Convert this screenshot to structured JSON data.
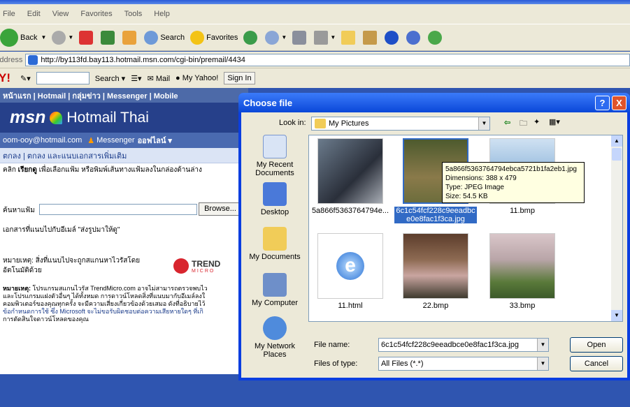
{
  "browser": {
    "menu": [
      "File",
      "Edit",
      "View",
      "Favorites",
      "Tools",
      "Help"
    ],
    "toolbar": {
      "back": "Back",
      "search": "Search",
      "favorites": "Favorites"
    },
    "address": {
      "label": "Address",
      "url": "http://by113fd.bay113.hotmail.msn.com/cgi-bin/premail/4434"
    },
    "yahoo": {
      "logo": "Y!",
      "search": "Search",
      "mail": "Mail",
      "my_yahoo": "My Yahoo!",
      "sign_in": "Sign In"
    }
  },
  "page": {
    "nav": "หน้าแรก | Hotmail | กลุ่มข่าว | Messenger | Mobile",
    "brand_msn": "msn",
    "brand_hotmail": "Hotmail Thai",
    "user": "oom-ooy@hotmail.com",
    "messenger": "Messenger",
    "status": "ออฟไลน์",
    "sub": "ตกลง | ตกลง และแนบเอกสารเพิ่มเติม",
    "instruction_prefix": "คลิก ",
    "instruction_bold": "เรียกดู",
    "instruction_rest": " เพื่อเลือกแฟ้ม หรือพิมพ์เส้นทางแฟ้มลงในกล่องด้านล่าง",
    "find_label": "ค้นหาแฟ้ม",
    "browse": "Browse...",
    "attach_text": "เอกสารที่แนบไปกับอีเมล์ \"ส่งรูปมาให้ดู\"",
    "note_label": "หมายเหตุ:",
    "note_line1": "หมายเหตุ: สิ่งที่แนบไปจะถูกสแกนหาไวรัสโดย",
    "note_line2": "อัตโนมัติด้วย",
    "trend_logo": "TREND",
    "trend_sub": "MICRO",
    "disclaimer_bold": "หมายเหตุ:",
    "disclaimer": [
      " โปรแกรมสแกนไวรัส TrendMicro.com อาจไม่สามารถตรวจพบไว",
      "และโปรแกรมแฝงตัวอื่นๆ ได้ทั้งหมด การดาวน์โหลดสิ่งที่แนบมากับอีเมล์ลงใ",
      "คอมพิวเตอร์ของคุณทุกครั้ง จะมีความเสี่ยงเกี่ยวข้องด้วยเสมอ ดังที่อธิบายไว้",
      "ข้อกำหนดการใช้ ซึ่ง Microsoft จะไม่ขอรับผิดชอบต่อความเสียหายใดๆ ที่เกิ",
      "การตัดสินใจดาวน์โหลดของคุณ"
    ]
  },
  "dialog": {
    "title": "Choose file",
    "help": "?",
    "close": "X",
    "look_in_label": "Look in:",
    "look_in_value": "My Pictures",
    "places": [
      "My Recent Documents",
      "Desktop",
      "My Documents",
      "My Computer",
      "My Network Places"
    ],
    "files": [
      {
        "name": "5a866f5363764794e...",
        "kind": "photo-people"
      },
      {
        "name": "6c1c54fcf228c9eeadbce0e8fac1f3ca.jpg",
        "kind": "photo-tree",
        "selected": true
      },
      {
        "name": "11.bmp",
        "kind": "photo-temple"
      },
      {
        "name": "11.html",
        "kind": "html"
      },
      {
        "name": "22.bmp",
        "kind": "photo-garden"
      },
      {
        "name": "33.bmp",
        "kind": "photo-river"
      }
    ],
    "tooltip": [
      "5a866f5363764794ebca5721b1fa2eb1.jpg",
      "Dimensions: 388 x 479",
      "Type: JPEG Image",
      "Size: 54.5 KB"
    ],
    "file_name_label": "File name:",
    "file_name_value": "6c1c54fcf228c9eeadbce0e8fac1f3ca.jpg",
    "file_type_label": "Files of type:",
    "file_type_value": "All Files (*.*)",
    "open": "Open",
    "cancel": "Cancel"
  },
  "colors": {
    "xp_blue": "#0a47d8",
    "hotmail_blue": "#26408a",
    "selection": "#316ac5"
  }
}
